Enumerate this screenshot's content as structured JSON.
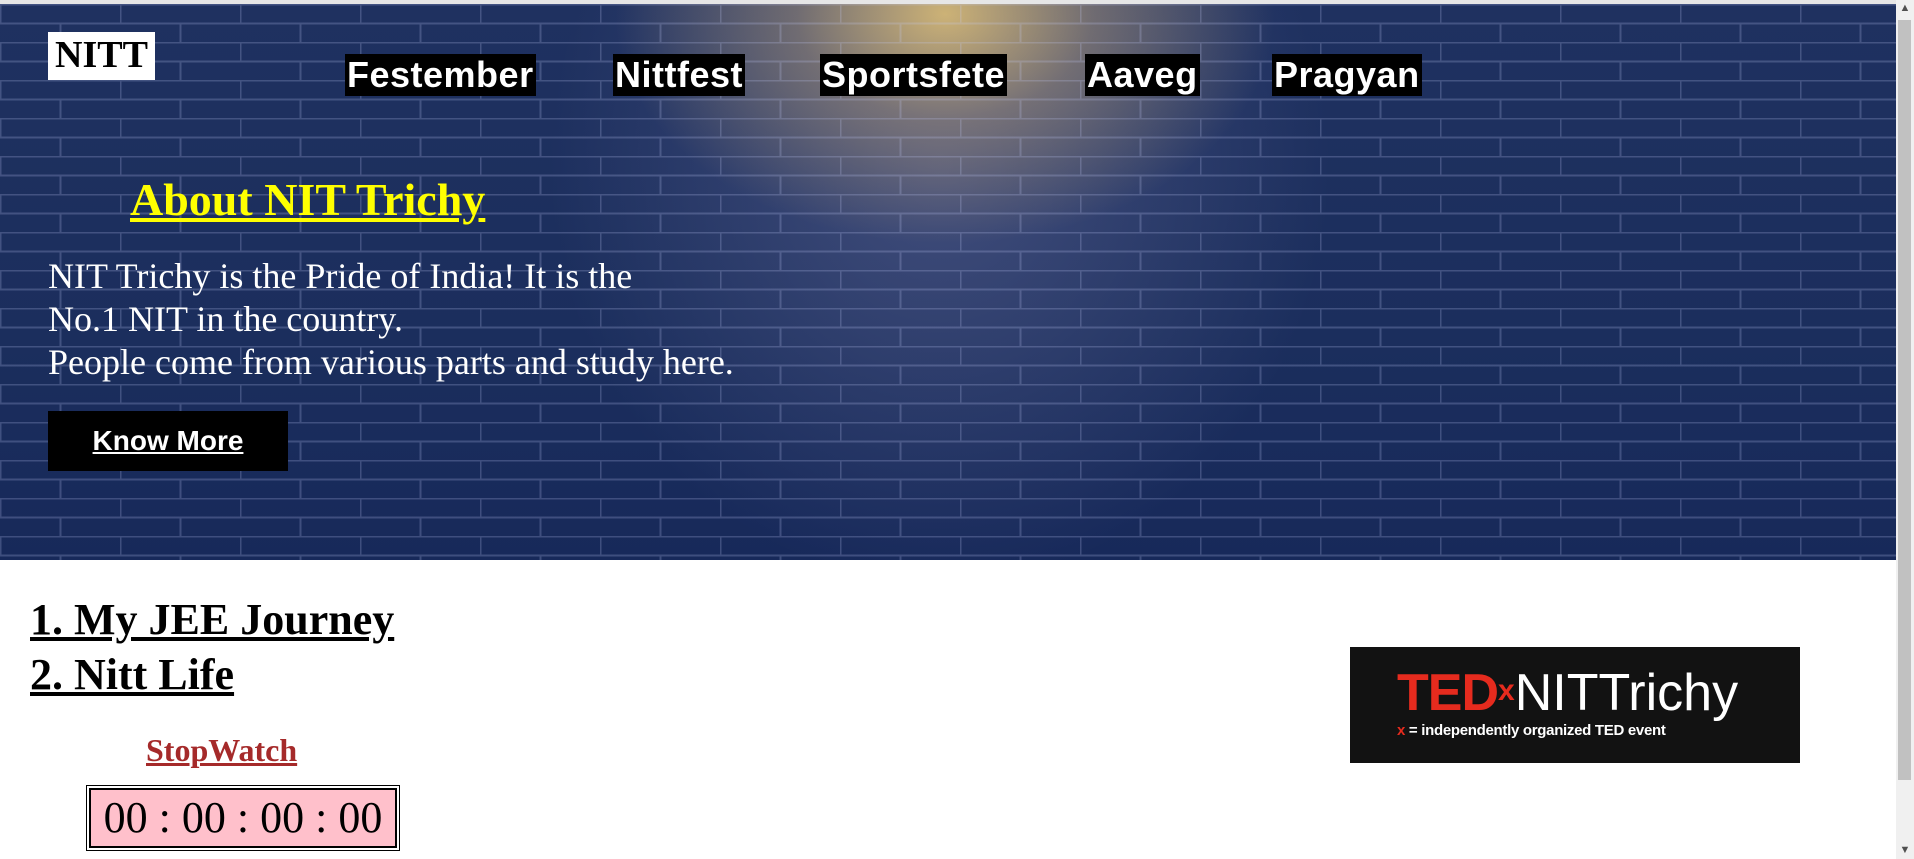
{
  "brand": {
    "logo": "NITT"
  },
  "nav": {
    "items": [
      "Festember",
      "Nittfest",
      "Sportsfete",
      "Aaveg",
      "Pragyan"
    ]
  },
  "about": {
    "title": "About NIT Trichy",
    "lines": [
      "NIT Trichy is the Pride of India! It is the",
      "No.1 NIT in the country.",
      "People come from various parts and study here."
    ],
    "button_label": "Know More"
  },
  "list": {
    "items": [
      "1. My JEE Journey",
      "2. Nitt Life"
    ]
  },
  "stopwatch": {
    "title": "StopWatch",
    "time": "00 : 00 : 00 : 00"
  },
  "tedx": {
    "ted": "TED",
    "x": "x",
    "name": "NITTrichy",
    "sub_x": "x",
    "sub": " = independently organized TED event"
  },
  "colors": {
    "about_title": "#ffff00",
    "stopwatch_title": "#a52a2a",
    "stopwatch_bg": "#ffc0cb",
    "ted_red": "#e62b1e",
    "hero_bg": "#1f3160"
  },
  "scrollbar": {
    "up_icon": "▲",
    "down_icon": "▼"
  }
}
